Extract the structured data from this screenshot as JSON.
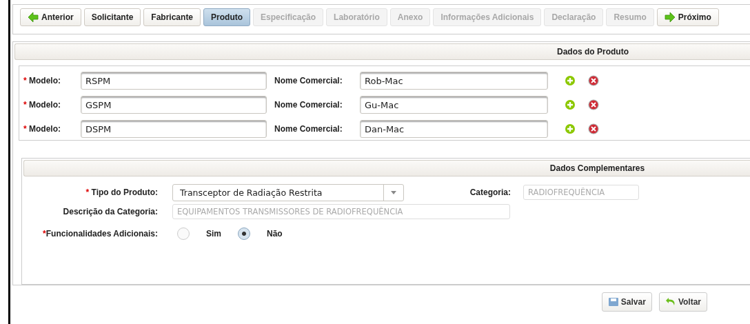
{
  "tabs": [
    {
      "label": "Anterior",
      "kind": "prev",
      "selected": false,
      "disabled": false
    },
    {
      "label": "Solicitante",
      "kind": "step",
      "selected": false,
      "disabled": false
    },
    {
      "label": "Fabricante",
      "kind": "step",
      "selected": false,
      "disabled": false
    },
    {
      "label": "Produto",
      "kind": "step",
      "selected": true,
      "disabled": false
    },
    {
      "label": "Especificação",
      "kind": "step",
      "selected": false,
      "disabled": true
    },
    {
      "label": "Laboratório",
      "kind": "step",
      "selected": false,
      "disabled": true
    },
    {
      "label": "Anexo",
      "kind": "step",
      "selected": false,
      "disabled": true
    },
    {
      "label": "Informações Adicionais",
      "kind": "step",
      "selected": false,
      "disabled": true
    },
    {
      "label": "Declaração",
      "kind": "step",
      "selected": false,
      "disabled": true
    },
    {
      "label": "Resumo",
      "kind": "step",
      "selected": false,
      "disabled": true
    },
    {
      "label": "Próximo",
      "kind": "next",
      "selected": false,
      "disabled": false
    }
  ],
  "product_panel": {
    "title": "Dados do Produto",
    "rows": [
      {
        "required_mark": "*",
        "model_label": "Modelo:",
        "model": "RSPM",
        "name_label": "Nome Comercial:",
        "name": "Rob-Mac"
      },
      {
        "required_mark": "*",
        "model_label": "Modelo:",
        "model": "GSPM",
        "name_label": "Nome Comercial:",
        "name": "Gu-Mac"
      },
      {
        "required_mark": "*",
        "model_label": "Modelo:",
        "model": "DSPM",
        "name_label": "Nome Comercial:",
        "name": "Dan-Mac"
      }
    ]
  },
  "complement_panel": {
    "title": "Dados Complementares",
    "product_type": {
      "required_mark": "*",
      "label": "Tipo do Produto:",
      "value": "Transceptor de Radiação Restrita"
    },
    "category": {
      "label": "Categoria:",
      "value": "RADIOFREQUÊNCIA",
      "disabled": true
    },
    "category_description": {
      "label": "Descrição da Categoria:",
      "value": "EQUIPAMENTOS TRANSMISSORES DE RADIOFREQUÊNCIA",
      "disabled": true
    },
    "additional_features": {
      "required_mark": "*",
      "label": "Funcionalidades Adicionais:",
      "options": [
        {
          "label": "Sim",
          "selected": false
        },
        {
          "label": "Não",
          "selected": true
        }
      ]
    }
  },
  "buttons": [
    {
      "label": "Salvar",
      "kind": "save"
    },
    {
      "label": "Voltar",
      "kind": "back"
    }
  ]
}
